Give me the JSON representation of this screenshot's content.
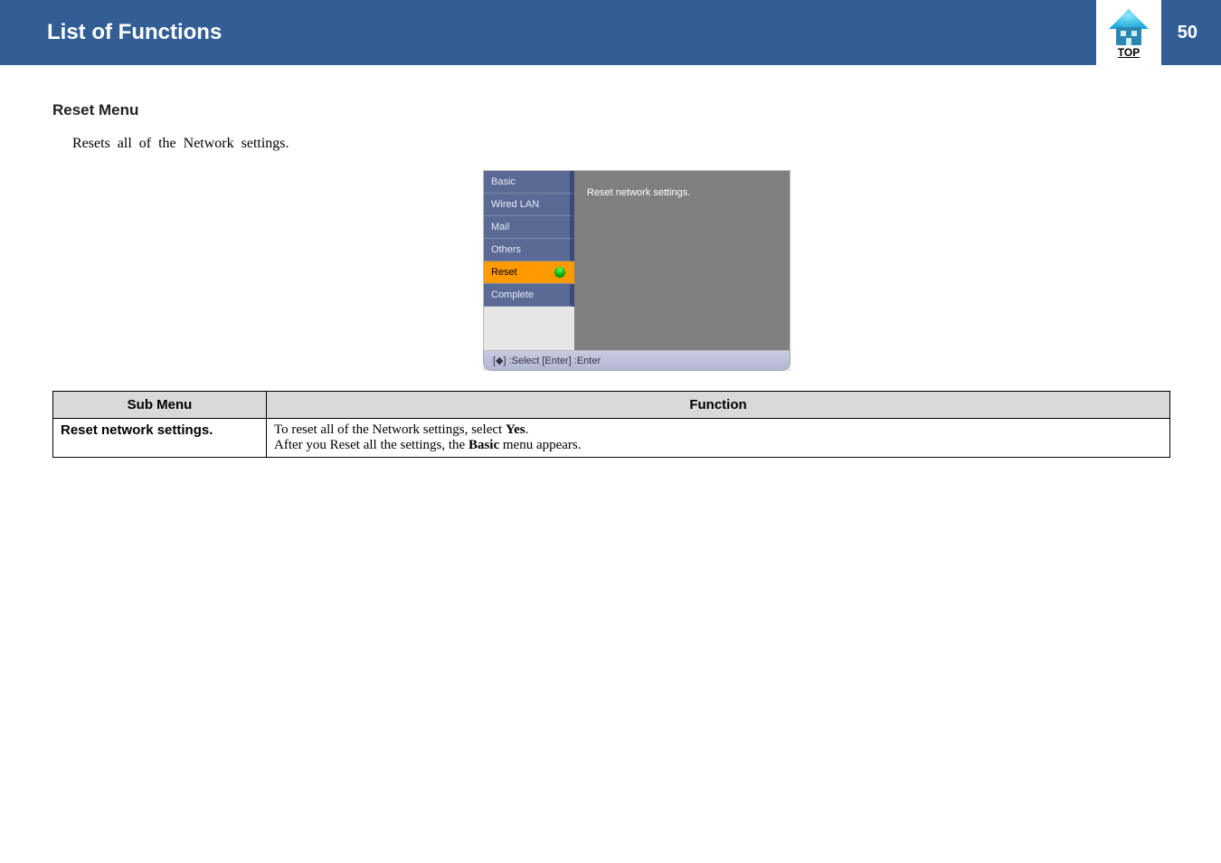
{
  "header": {
    "title": "List of Functions",
    "top_label": "TOP",
    "page_number": "50"
  },
  "section": {
    "heading": "Reset Menu",
    "body": "Resets all of the Network settings."
  },
  "menu": {
    "tabs": [
      "Basic",
      "Wired LAN",
      "Mail",
      "Others",
      "Reset",
      "Complete"
    ],
    "selected_index": 4,
    "right_text": "Reset network settings.",
    "footer": "[◆] :Select  [Enter] :Enter"
  },
  "table": {
    "headers": [
      "Sub Menu",
      "Function"
    ],
    "rows": [
      {
        "sub_menu": "Reset network settings.",
        "function_line1_pre": "To reset all of the Network settings, select ",
        "function_line1_bold": "Yes",
        "function_line1_post": ".",
        "function_line2_pre": "After you Reset all the settings, the ",
        "function_line2_bold": "Basic",
        "function_line2_post": " menu appears."
      }
    ]
  }
}
